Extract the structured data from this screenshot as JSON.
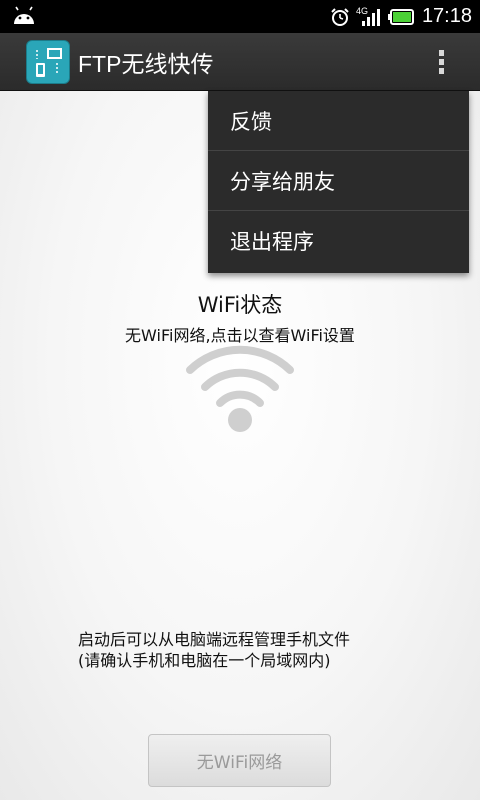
{
  "status_bar": {
    "time": "17:18",
    "network": "4G",
    "icons": [
      "android-icon",
      "alarm-icon",
      "signal-icon",
      "battery-icon"
    ]
  },
  "action_bar": {
    "title": "FTP无线快传",
    "icon": "app-icon",
    "overflow_icon": "overflow-menu-icon"
  },
  "menu": {
    "items": [
      {
        "label": "反馈"
      },
      {
        "label": "分享给朋友"
      },
      {
        "label": "退出程序"
      }
    ]
  },
  "wifi": {
    "title": "WiFi状态",
    "subtitle": "无WiFi网络,点击以查看WiFi设置",
    "icon": "wifi-icon"
  },
  "info": {
    "line1": "启动后可以从电脑端远程管理手机文件",
    "line2": "(请确认手机和电脑在一个局域网内)"
  },
  "button": {
    "label": "无WiFi网络"
  },
  "colors": {
    "action_bar": "#2f2f2f",
    "menu_bg": "#2b2b2b",
    "app_icon": "#2aa6b8",
    "battery": "#4cd137"
  }
}
